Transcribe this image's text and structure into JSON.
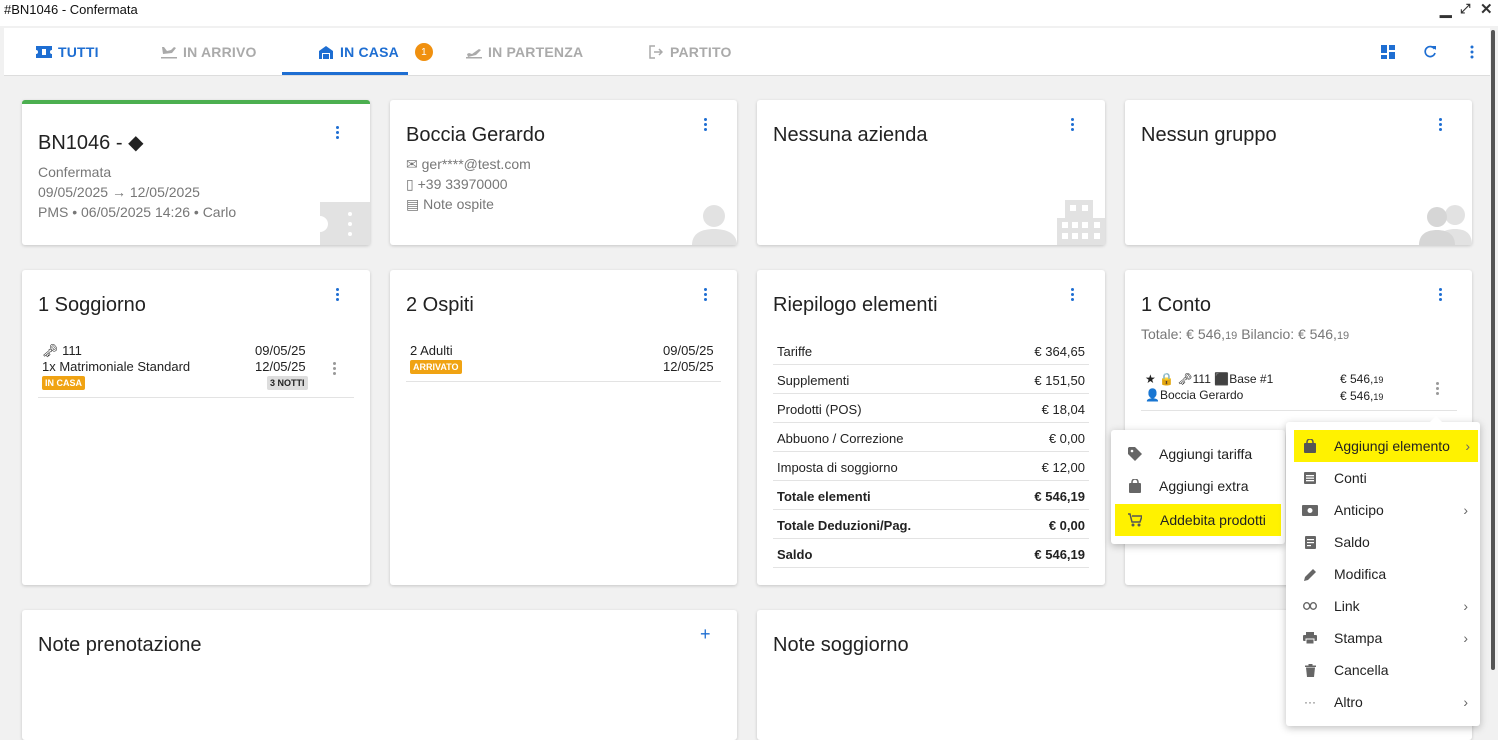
{
  "window": {
    "title": "#BN1046 - Confermata"
  },
  "tabs": [
    {
      "label": "TUTTI",
      "icon": "ticket-icon"
    },
    {
      "label": "IN ARRIVO",
      "icon": "plane-landing-icon"
    },
    {
      "label": "IN CASA",
      "icon": "house-icon",
      "badge": "1"
    },
    {
      "label": "IN PARTENZA",
      "icon": "plane-departing-icon"
    },
    {
      "label": "PARTITO",
      "icon": "logout-icon"
    }
  ],
  "booking": {
    "title": "BN1046 -",
    "status": "Confermata",
    "dates": "09/05/2025 → 12/05/2025",
    "origin": "PMS • 06/05/2025 14:26 • Carlo"
  },
  "guest": {
    "name": "Boccia Gerardo",
    "email": "ger****@test.com",
    "phone": "+39 33970000",
    "notes": "Note ospite"
  },
  "company": {
    "title": "Nessuna azienda"
  },
  "group": {
    "title": "Nessun gruppo"
  },
  "stay": {
    "title": "1 Soggiorno",
    "room": "111",
    "room_type": "1x Matrimoniale Standard",
    "status": "IN CASA",
    "checkin": "09/05/25",
    "checkout": "12/05/25",
    "nights": "3 NOTTI"
  },
  "guests": {
    "title": "2 Ospiti",
    "count": "2 Adulti",
    "status": "ARRIVATO",
    "checkin": "09/05/25",
    "checkout": "12/05/25"
  },
  "summary": {
    "title": "Riepilogo elementi",
    "rows": [
      {
        "label": "Tariffe",
        "value": "€ 364,65"
      },
      {
        "label": "Supplementi",
        "value": "€ 151,50"
      },
      {
        "label": "Prodotti (POS)",
        "value": "€ 18,04"
      },
      {
        "label": "Abbuono / Correzione",
        "value": "€ 0,00"
      },
      {
        "label": "Imposta di soggiorno",
        "value": "€ 12,00"
      },
      {
        "label": "Totale elementi",
        "value": "€ 546,19"
      },
      {
        "label": "Totale Deduzioni/Pag.",
        "value": "€ 0,00"
      },
      {
        "label": "Saldo",
        "value": "€ 546,19"
      }
    ]
  },
  "account": {
    "title": "1 Conto",
    "totals_a": "Totale: € 546,",
    "totals_a_cents": "19",
    "totals_b": " Bilancio: € 546,",
    "totals_b_cents": "19",
    "room": "111",
    "rate": "Base",
    "rate_num": "#1",
    "holder": "Boccia Gerardo",
    "amount1": "€ 546,",
    "amount1_cents": "19",
    "amount2": "€ 546,",
    "amount2_cents": "19"
  },
  "notes": {
    "booking_title": "Note prenotazione",
    "stay_title": "Note soggiorno"
  },
  "menu_main": [
    {
      "label": "Aggiungi elemento",
      "icon": "bag-icon",
      "sub": true
    },
    {
      "label": "Conti",
      "icon": "list-icon",
      "sub": false
    },
    {
      "label": "Anticipo",
      "icon": "cash-icon",
      "sub": true
    },
    {
      "label": "Saldo",
      "icon": "receipt-icon",
      "sub": false
    },
    {
      "label": "Modifica",
      "icon": "pencil-icon",
      "sub": false
    },
    {
      "label": "Link",
      "icon": "link-icon",
      "sub": true
    },
    {
      "label": "Stampa",
      "icon": "printer-icon",
      "sub": true
    },
    {
      "label": "Cancella",
      "icon": "trash-icon",
      "sub": false
    },
    {
      "label": "Altro",
      "icon": "more-horiz-icon",
      "sub": true
    }
  ],
  "menu_sub": [
    {
      "label": "Aggiungi tariffa",
      "icon": "tag-icon"
    },
    {
      "label": "Aggiungi extra",
      "icon": "bag-icon"
    },
    {
      "label": "Addebita prodotti",
      "icon": "cart-icon"
    }
  ],
  "colors": {
    "accent": "#1e6ed2",
    "highlight": "#fff200",
    "badge": "#f0900f",
    "green_bar": "#4caf50"
  }
}
